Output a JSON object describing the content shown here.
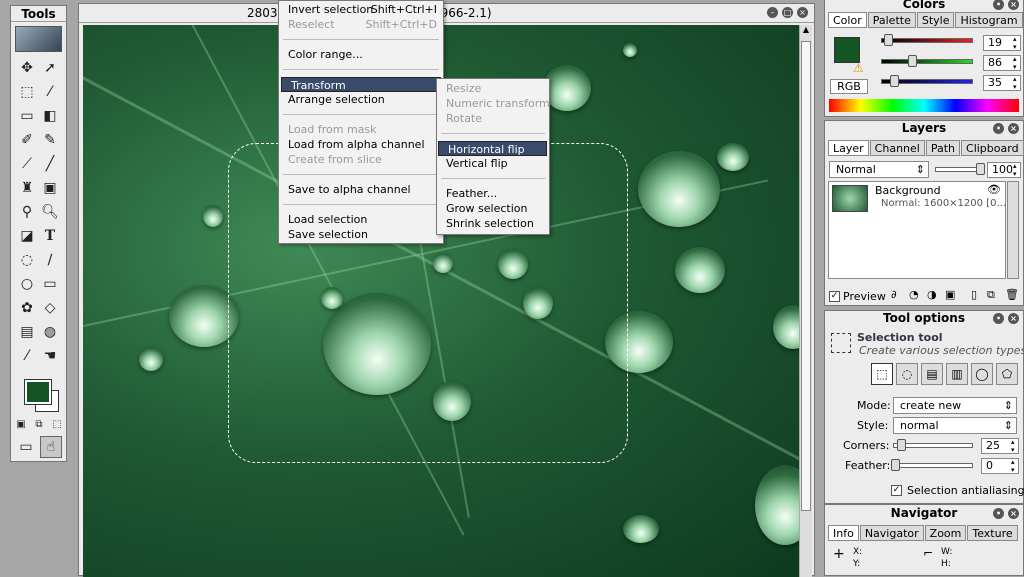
{
  "tools": {
    "title": "Tools"
  },
  "image_window": {
    "title": "28034 … 00% (RGB/sRGB IEC61966-2.1)"
  },
  "select_menu": {
    "invert_selection": "Invert selection",
    "invert_shortcut": "Shift+Ctrl+I",
    "reselect": "Reselect",
    "reselect_shortcut": "Shift+Ctrl+D",
    "color_range": "Color range...",
    "transform": "Transform",
    "arrange_selection": "Arrange selection",
    "load_from_mask": "Load from mask",
    "load_from_alpha": "Load from alpha channel",
    "create_from_slice": "Create from slice",
    "save_to_alpha": "Save to alpha channel",
    "load_selection": "Load selection",
    "save_selection": "Save selection"
  },
  "transform_menu": {
    "resize": "Resize",
    "numeric_transform": "Numeric transform",
    "rotate": "Rotate",
    "horizontal_flip": "Horizontal flip",
    "vertical_flip": "Vertical flip",
    "feather": "Feather...",
    "grow_selection": "Grow selection",
    "shrink_selection": "Shrink selection"
  },
  "colors": {
    "title": "Colors",
    "tabs": [
      "Color",
      "Palette",
      "Style",
      "Histogram"
    ],
    "mode": "RGB",
    "r": "19",
    "g": "86",
    "b": "35",
    "r_level": 0.075,
    "g_level": 0.337,
    "b_level": 0.137,
    "fg": "#135623"
  },
  "layers": {
    "title": "Layers",
    "tabs": [
      "Layer",
      "Channel",
      "Path",
      "Clipboard"
    ],
    "blend_mode": "Normal",
    "opacity": "100",
    "layer_name": "Background",
    "layer_info": "Normal: 1600×1200 [0...",
    "preview": "Preview"
  },
  "tool_options": {
    "title": "Tool options",
    "tool_name": "Selection tool",
    "tool_desc": "Create various selection types",
    "mode_label": "Mode:",
    "mode_value": "create new",
    "style_label": "Style:",
    "style_value": "normal",
    "corners_label": "Corners:",
    "corners_value": "25",
    "feather_label": "Feather:",
    "feather_value": "0",
    "antialias": "Selection antialiasing"
  },
  "navigator": {
    "title": "Navigator",
    "tabs": [
      "Info",
      "Navigator",
      "Zoom",
      "Texture"
    ],
    "x": "X:",
    "y": "Y:",
    "w": "W:",
    "h": "H:"
  }
}
